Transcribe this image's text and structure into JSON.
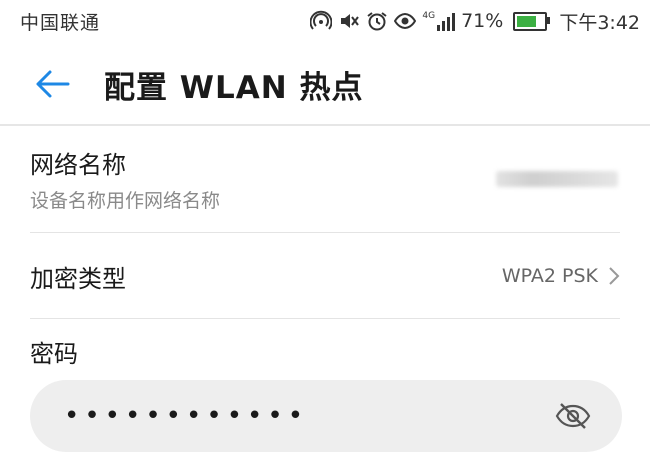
{
  "status_bar": {
    "carrier": "中国联通",
    "network_label": "4G",
    "battery_percent": "71%",
    "battery_level": 0.71,
    "time": "下午3:42",
    "icons": [
      "hotspot-icon",
      "mute-icon",
      "alarm-icon",
      "eye-comfort-icon",
      "signal-icon",
      "battery-icon"
    ]
  },
  "app_bar": {
    "title": "配置 WLAN 热点",
    "back_icon": "arrow-left-icon"
  },
  "settings": {
    "network_name": {
      "title": "网络名称",
      "subtitle": "设备名称用作网络名称"
    },
    "encryption": {
      "title": "加密类型",
      "value": "WPA2 PSK"
    },
    "password": {
      "label": "密码",
      "value": "••••••••••••",
      "toggle_icon": "eye-hidden-icon"
    }
  },
  "colors": {
    "accent": "#1e88e5",
    "field_bg": "#eeeeee",
    "battery_fill": "#3cb043"
  }
}
